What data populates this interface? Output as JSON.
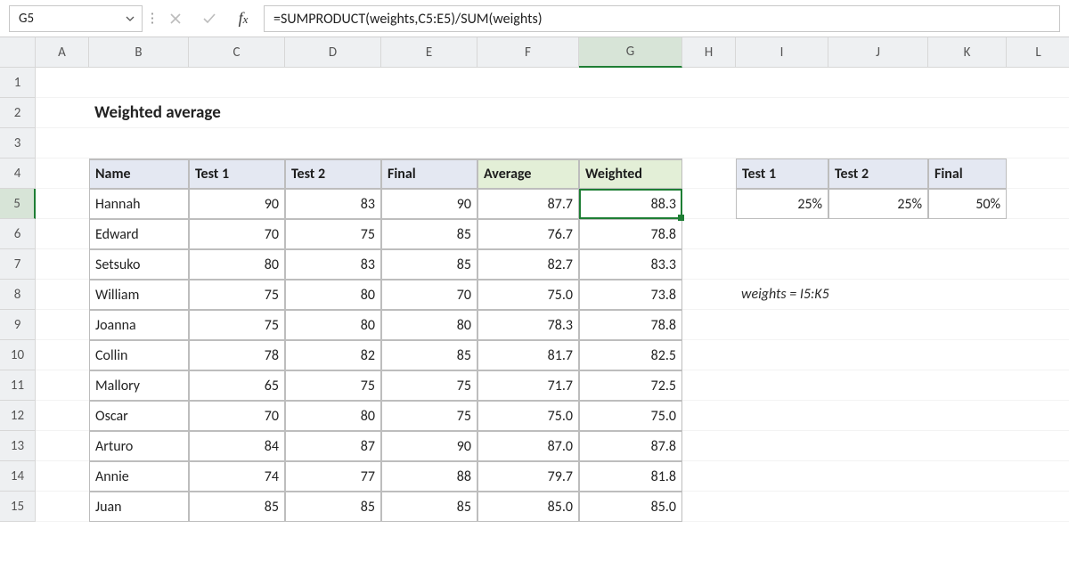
{
  "namebox": "G5",
  "formula": "=SUMPRODUCT(weights,C5:E5)/SUM(weights)",
  "columns": [
    "A",
    "B",
    "C",
    "D",
    "E",
    "F",
    "G",
    "H",
    "I",
    "J",
    "K",
    "L"
  ],
  "rows": [
    "1",
    "2",
    "3",
    "4",
    "5",
    "6",
    "7",
    "8",
    "9",
    "10",
    "11",
    "12",
    "13",
    "14",
    "15"
  ],
  "title": "Weighted average",
  "note": "weights = I5:K5",
  "headers": {
    "name": "Name",
    "test1": "Test 1",
    "test2": "Test 2",
    "final": "Final",
    "avg": "Average",
    "weighted": "Weighted"
  },
  "weights_headers": {
    "test1": "Test 1",
    "test2": "Test 2",
    "final": "Final"
  },
  "weights_values": {
    "test1": "25%",
    "test2": "25%",
    "final": "50%"
  },
  "scores": [
    {
      "name": "Hannah",
      "t1": "90",
      "t2": "83",
      "fin": "90",
      "avg": "87.7",
      "w": "88.3"
    },
    {
      "name": "Edward",
      "t1": "70",
      "t2": "75",
      "fin": "85",
      "avg": "76.7",
      "w": "78.8"
    },
    {
      "name": "Setsuko",
      "t1": "80",
      "t2": "83",
      "fin": "85",
      "avg": "82.7",
      "w": "83.3"
    },
    {
      "name": "William",
      "t1": "75",
      "t2": "80",
      "fin": "70",
      "avg": "75.0",
      "w": "73.8"
    },
    {
      "name": "Joanna",
      "t1": "75",
      "t2": "80",
      "fin": "80",
      "avg": "78.3",
      "w": "78.8"
    },
    {
      "name": "Collin",
      "t1": "78",
      "t2": "82",
      "fin": "85",
      "avg": "81.7",
      "w": "82.5"
    },
    {
      "name": "Mallory",
      "t1": "65",
      "t2": "75",
      "fin": "75",
      "avg": "71.7",
      "w": "72.5"
    },
    {
      "name": "Oscar",
      "t1": "70",
      "t2": "80",
      "fin": "75",
      "avg": "75.0",
      "w": "75.0"
    },
    {
      "name": "Arturo",
      "t1": "84",
      "t2": "87",
      "fin": "90",
      "avg": "87.0",
      "w": "87.8"
    },
    {
      "name": "Annie",
      "t1": "74",
      "t2": "77",
      "fin": "88",
      "avg": "79.7",
      "w": "81.8"
    },
    {
      "name": "Juan",
      "t1": "85",
      "t2": "85",
      "fin": "85",
      "avg": "85.0",
      "w": "85.0"
    }
  ],
  "chart_data": {
    "type": "table",
    "title": "Weighted average",
    "columns": [
      "Name",
      "Test 1",
      "Test 2",
      "Final",
      "Average",
      "Weighted"
    ],
    "rows": [
      [
        "Hannah",
        90,
        83,
        90,
        87.7,
        88.3
      ],
      [
        "Edward",
        70,
        75,
        85,
        76.7,
        78.8
      ],
      [
        "Setsuko",
        80,
        83,
        85,
        82.7,
        83.3
      ],
      [
        "William",
        75,
        80,
        70,
        75.0,
        73.8
      ],
      [
        "Joanna",
        75,
        80,
        80,
        78.3,
        78.8
      ],
      [
        "Collin",
        78,
        82,
        85,
        81.7,
        82.5
      ],
      [
        "Mallory",
        65,
        75,
        75,
        71.7,
        72.5
      ],
      [
        "Oscar",
        70,
        80,
        75,
        75.0,
        75.0
      ],
      [
        "Arturo",
        84,
        87,
        90,
        87.0,
        87.8
      ],
      [
        "Annie",
        74,
        77,
        88,
        79.7,
        81.8
      ],
      [
        "Juan",
        85,
        85,
        85,
        85.0,
        85.0
      ]
    ],
    "weights": {
      "Test 1": 0.25,
      "Test 2": 0.25,
      "Final": 0.5
    },
    "formula": "=SUMPRODUCT(weights,C5:E5)/SUM(weights)"
  }
}
